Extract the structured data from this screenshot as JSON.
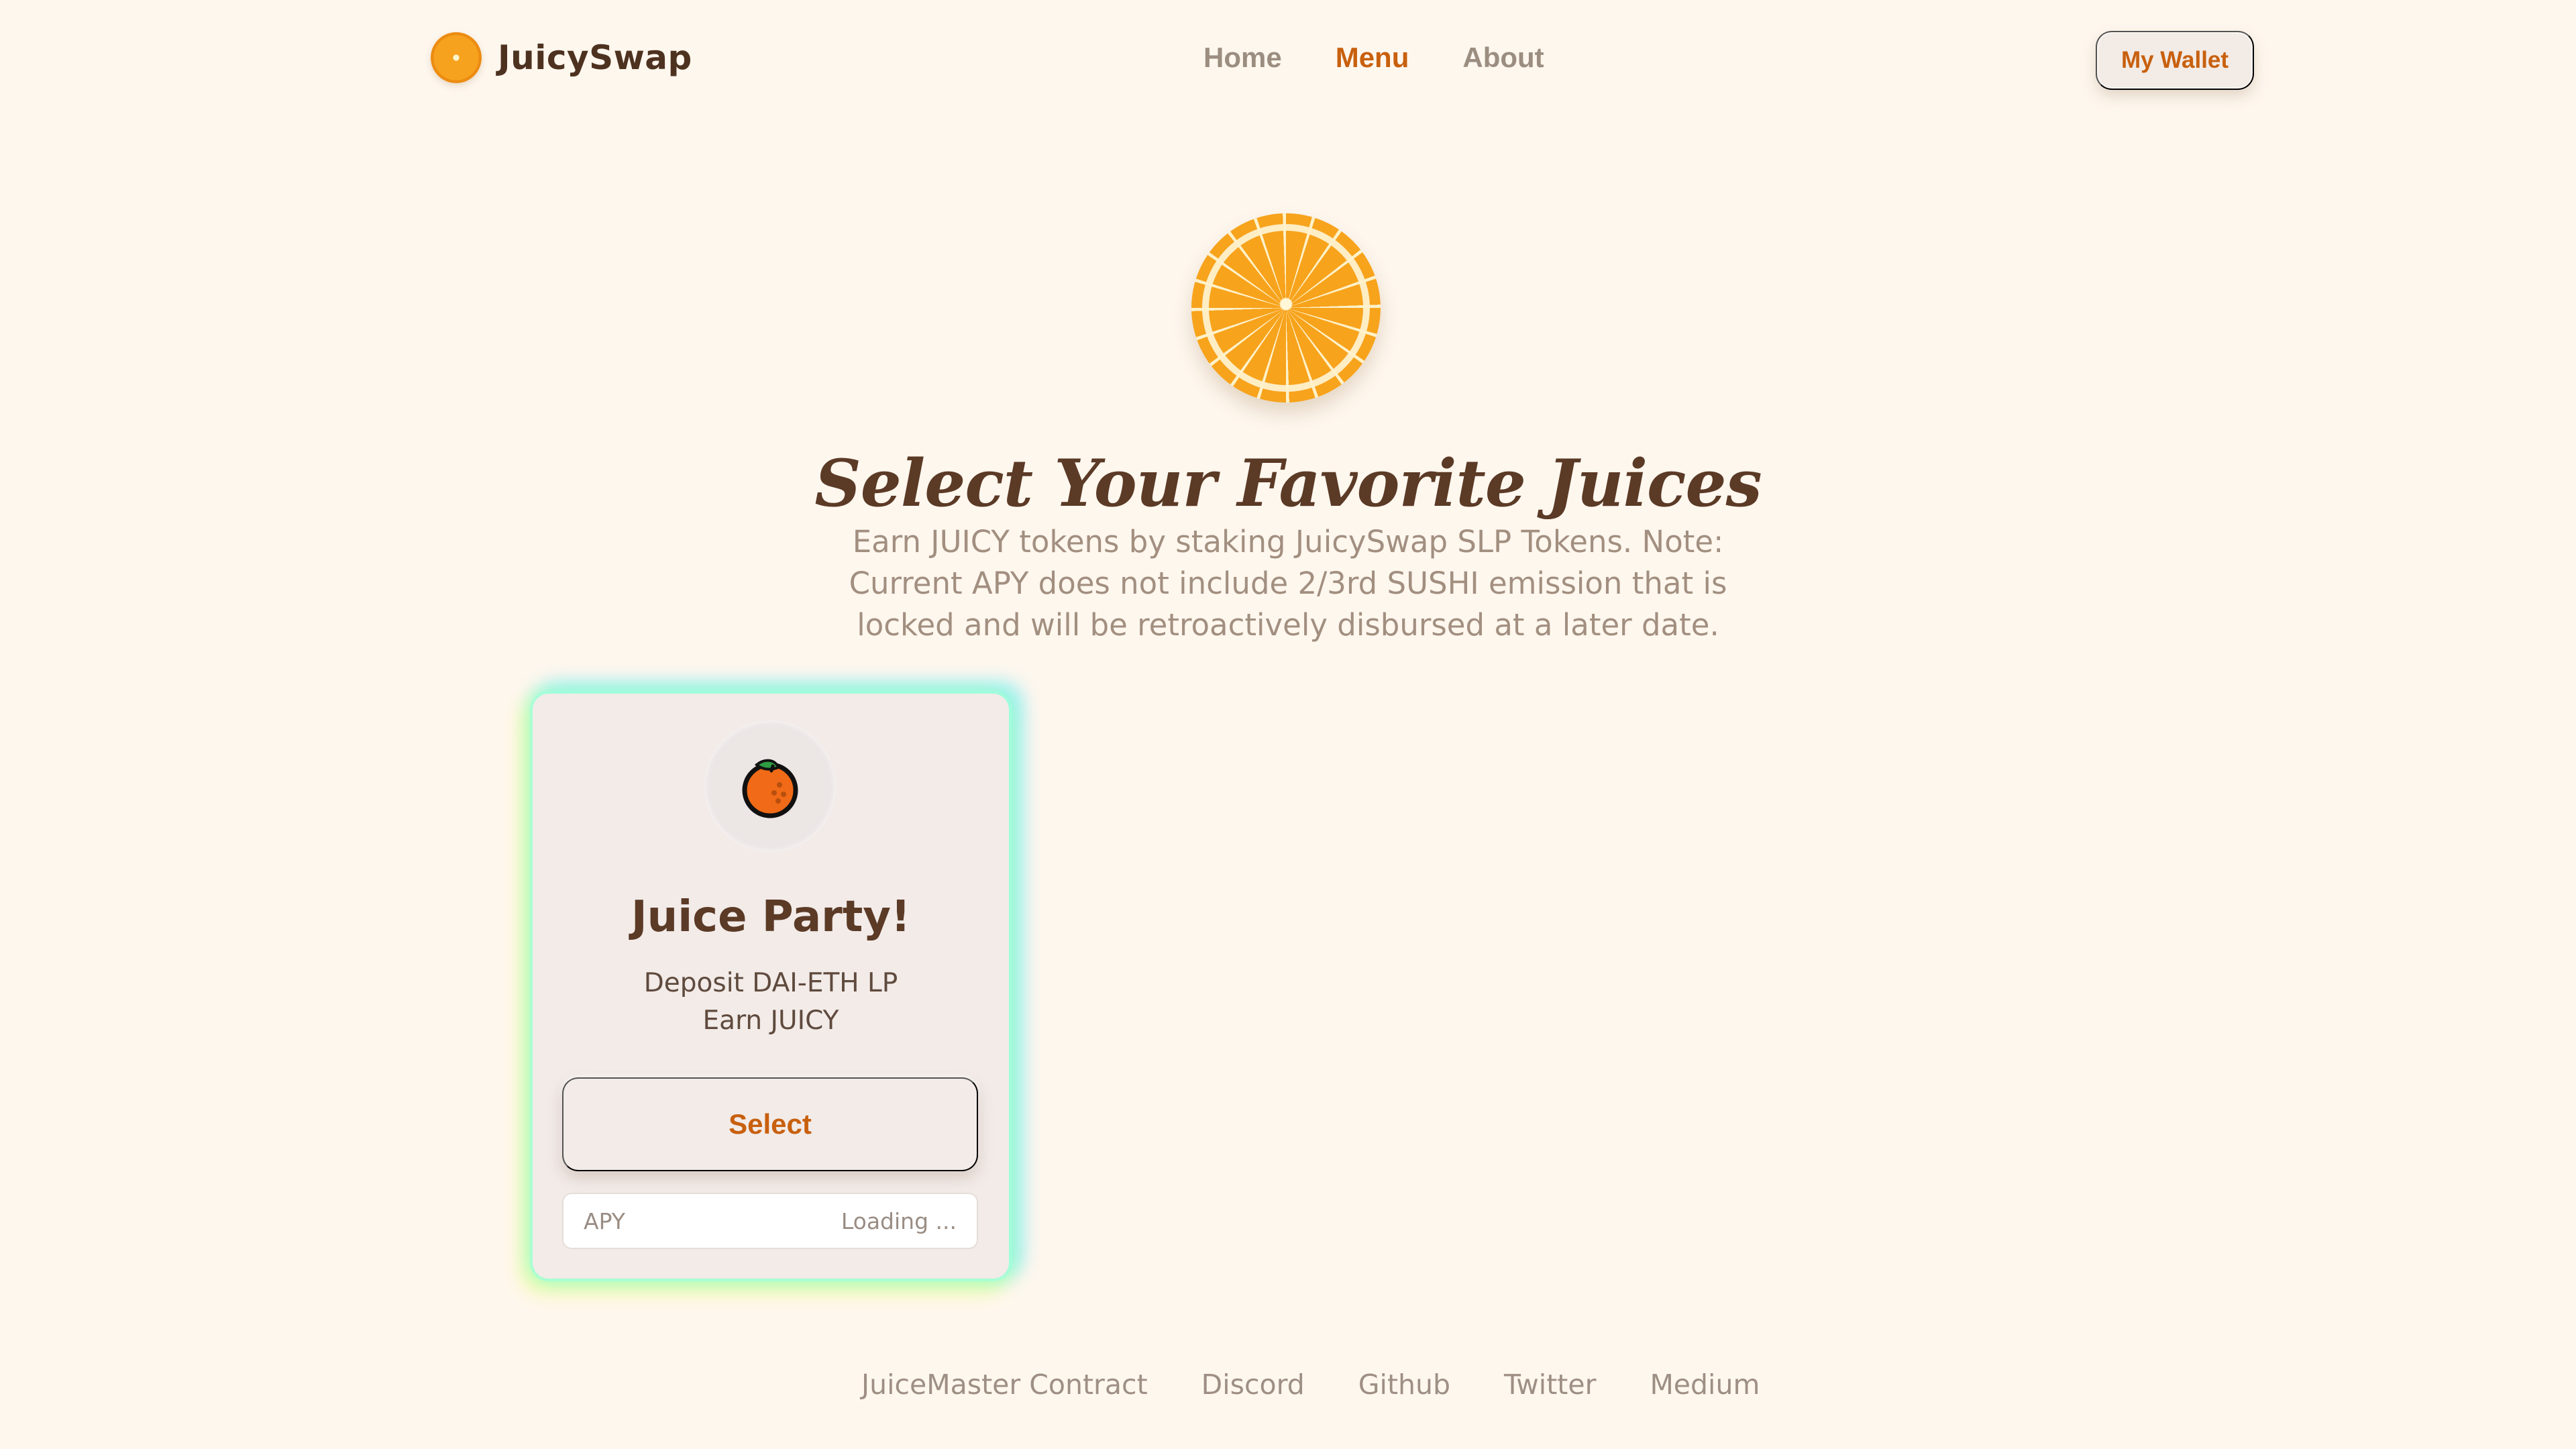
{
  "header": {
    "brand": "JuicySwap",
    "nav": [
      {
        "label": "Home",
        "active": false
      },
      {
        "label": "Menu",
        "active": true
      },
      {
        "label": "About",
        "active": false
      }
    ],
    "wallet_button": "My Wallet"
  },
  "hero": {
    "title": "Select Your Favorite Juices",
    "subtitle": "Earn JUICY tokens by staking JuicySwap SLP Tokens. Note: Current APY does not include 2/3rd SUSHI emission that is locked and will be retroactively disbursed at a later date."
  },
  "cards": [
    {
      "title": "Juice Party!",
      "deposit": "Deposit DAI-ETH LP",
      "earn": "Earn JUICY",
      "select_label": "Select",
      "apy_label": "APY",
      "apy_value": "Loading ..."
    }
  ],
  "footer": {
    "links": [
      "JuiceMaster Contract",
      "Discord",
      "Github",
      "Twitter",
      "Medium"
    ]
  },
  "colors": {
    "background": "#fef7ee",
    "accent": "#c8600e",
    "heading": "#5b3a26"
  },
  "icons": {
    "brand": "orange-slice-icon",
    "hero": "orange-slice-icon",
    "card": "tangerine-icon"
  }
}
